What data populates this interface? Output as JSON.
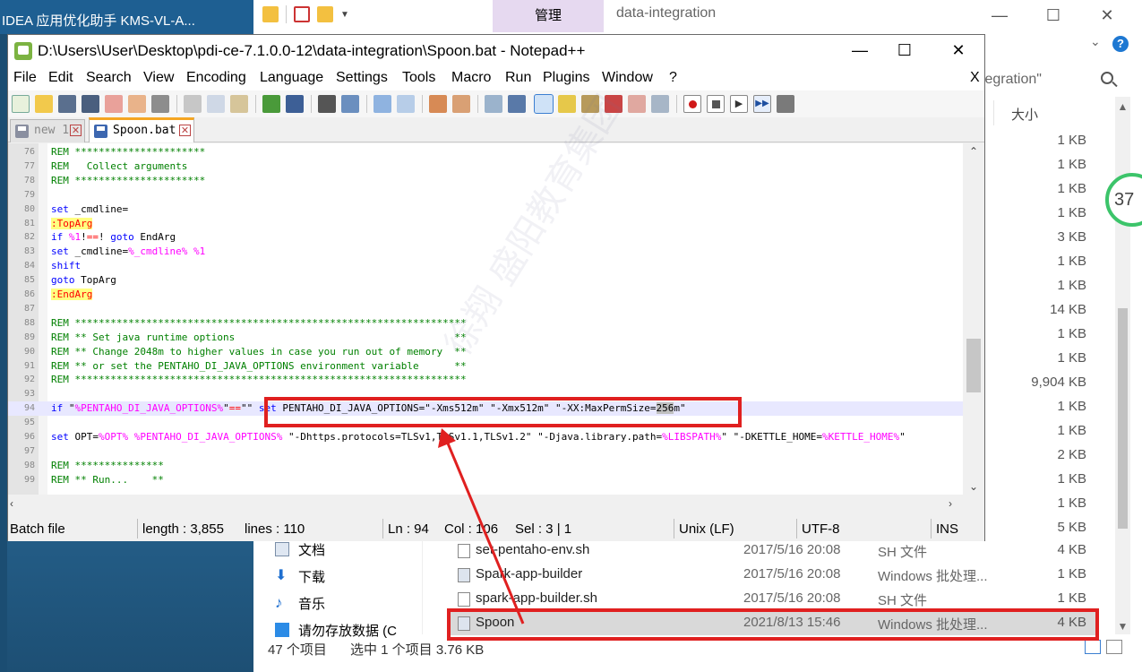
{
  "desktop": {
    "taskbar_title": "IDEA  应用优化助手  KMS-VL-A..."
  },
  "explorer": {
    "manage_tab": "管理",
    "title": "data-integration",
    "search_value": "tegration\"",
    "size_column_header": "大小",
    "sizes": [
      "1 KB",
      "1 KB",
      "1 KB",
      "1 KB",
      "3 KB",
      "1 KB",
      "1 KB",
      "14 KB",
      "1 KB",
      "1 KB",
      "9,904 KB",
      "1 KB",
      "1 KB",
      "2 KB",
      "1 KB",
      "1 KB",
      "5 KB"
    ],
    "nav": [
      {
        "label": "文档",
        "icon": "document-icon"
      },
      {
        "label": "下载",
        "icon": "download-icon"
      },
      {
        "label": "音乐",
        "icon": "music-icon"
      },
      {
        "label": "请勿存放数据 (C",
        "icon": "drive-icon"
      }
    ],
    "files": [
      {
        "name": "set-pentaho-env.sh",
        "date": "2017/5/16 20:08",
        "type": "SH 文件",
        "size": "4 KB",
        "selected": false
      },
      {
        "name": "Spark-app-builder",
        "date": "2017/5/16 20:08",
        "type": "Windows 批处理...",
        "size": "1 KB",
        "selected": false
      },
      {
        "name": "spark-app-builder.sh",
        "date": "2017/5/16 20:08",
        "type": "SH 文件",
        "size": "1 KB",
        "selected": false
      },
      {
        "name": "Spoon",
        "date": "2021/8/13 15:46",
        "type": "Windows 批处理...",
        "size": "4 KB",
        "selected": true
      }
    ],
    "status": {
      "count": "47 个项目",
      "selected": "选中 1 个项目  3.76 KB"
    },
    "gauge_value": "37"
  },
  "notepad": {
    "title": "D:\\Users\\User\\Desktop\\pdi-ce-7.1.0.0-12\\data-integration\\Spoon.bat - Notepad++",
    "menu": [
      "File",
      "Edit",
      "Search",
      "View",
      "Encoding",
      "Language",
      "Settings",
      "Tools",
      "Macro",
      "Run",
      "Plugins",
      "Window",
      "?"
    ],
    "menu_close": "X",
    "tabs": [
      {
        "label": "new 1",
        "active": false
      },
      {
        "label": "Spoon.bat",
        "active": true
      }
    ],
    "lines": [
      {
        "n": "76",
        "text": "REM **********************"
      },
      {
        "n": "77",
        "text": "REM   Collect arguments"
      },
      {
        "n": "78",
        "text": "REM **********************"
      },
      {
        "n": "79",
        "text": ""
      },
      {
        "n": "80",
        "text": "set _cmdline="
      },
      {
        "n": "81",
        "text": ":TopArg"
      },
      {
        "n": "82",
        "text": "if %1!==! goto EndArg"
      },
      {
        "n": "83",
        "text": "set _cmdline=%_cmdline% %1"
      },
      {
        "n": "84",
        "text": "shift"
      },
      {
        "n": "85",
        "text": "goto TopArg"
      },
      {
        "n": "86",
        "text": ":EndArg"
      },
      {
        "n": "87",
        "text": ""
      },
      {
        "n": "88",
        "text": "REM ******************************************************************"
      },
      {
        "n": "89",
        "text": "REM ** Set java runtime options                                     **"
      },
      {
        "n": "90",
        "text": "REM ** Change 2048m to higher values in case you run out of memory  **"
      },
      {
        "n": "91",
        "text": "REM ** or set the PENTAHO_DI_JAVA_OPTIONS environment variable      **"
      },
      {
        "n": "92",
        "text": "REM ******************************************************************"
      },
      {
        "n": "93",
        "text": ""
      },
      {
        "n": "94",
        "text": "if \"%PENTAHO_DI_JAVA_OPTIONS%\"==\"\" set PENTAHO_DI_JAVA_OPTIONS=\"-Xms512m\" \"-Xmx512m\" \"-XX:MaxPermSize=256m\""
      },
      {
        "n": "95",
        "text": ""
      },
      {
        "n": "96",
        "text": "set OPT=%OPT% %PENTAHO_DI_JAVA_OPTIONS% \"-Dhttps.protocols=TLSv1,TLSv1.1,TLSv1.2\" \"-Djava.library.path=%LIBSPATH%\" \"-DKETTLE_HOME=%KETTLE_HOME%\""
      },
      {
        "n": "97",
        "text": ""
      },
      {
        "n": "98",
        "text": "REM ***************"
      },
      {
        "n": "99",
        "text": "REM ** Run...    **"
      }
    ],
    "status": {
      "filetype": "Batch file",
      "length": "length : 3,855",
      "lines": "lines : 110",
      "ln": "Ln : 94",
      "col": "Col : 106",
      "sel": "Sel : 3 | 1",
      "eol": "Unix (LF)",
      "encoding": "UTF-8",
      "mode": "INS"
    }
  },
  "watermark": "徐翔 盛阳教育集团",
  "colors": {
    "annotation": "#e02020",
    "keyword": "#0000ff",
    "comment": "#008000",
    "variable": "#ff00ff",
    "label_bg": "#ffff80"
  }
}
